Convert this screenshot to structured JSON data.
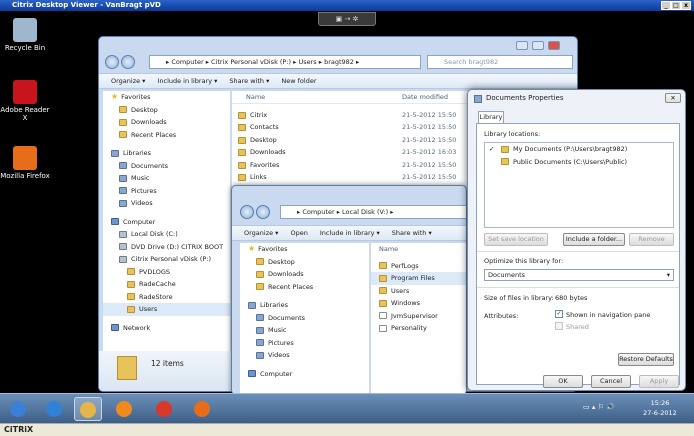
{
  "window_title": "Citrix Desktop Viewer - VanBragt pVD",
  "toolbar_glyph": "▣ ⇢ ✲",
  "desktop_icons": [
    {
      "label": "Recycle Bin",
      "icon": "recycle-bin-icon",
      "color": "#9fb7cc"
    },
    {
      "label": "Adobe Reader X",
      "icon": "adobe-reader-icon",
      "color": "#c8141c"
    },
    {
      "label": "Mozilla Firefox",
      "icon": "firefox-icon",
      "color": "#e76d1b"
    }
  ],
  "explorer1": {
    "breadcrumb": "▸ Computer ▸ Citrix Personal vDisk (P:) ▸ Users ▸ bragt982 ▸",
    "search_placeholder": "Search bragt982",
    "commands": [
      "Organize ▾",
      "Include in library ▾",
      "Share with ▾",
      "New folder"
    ],
    "nav": [
      {
        "label": "Favorites",
        "kind": "star",
        "level": 0
      },
      {
        "label": "Desktop",
        "kind": "folder",
        "level": 1
      },
      {
        "label": "Downloads",
        "kind": "folder",
        "level": 1
      },
      {
        "label": "Recent Places",
        "kind": "folder",
        "level": 1
      },
      {
        "label": "",
        "kind": "gap",
        "level": 0
      },
      {
        "label": "Libraries",
        "kind": "lib",
        "level": 0
      },
      {
        "label": "Documents",
        "kind": "lib",
        "level": 1
      },
      {
        "label": "Music",
        "kind": "lib",
        "level": 1
      },
      {
        "label": "Pictures",
        "kind": "lib",
        "level": 1
      },
      {
        "label": "Videos",
        "kind": "lib",
        "level": 1
      },
      {
        "label": "",
        "kind": "gap",
        "level": 0
      },
      {
        "label": "Computer",
        "kind": "pc",
        "level": 0
      },
      {
        "label": "Local Disk (C:)",
        "kind": "drive",
        "level": 1
      },
      {
        "label": "DVD Drive (D:) CITRIX BOOT",
        "kind": "drive",
        "level": 1
      },
      {
        "label": "Citrix Personal vDisk (P:)",
        "kind": "drive",
        "level": 1
      },
      {
        "label": "PVDLOGS",
        "kind": "folder",
        "level": 2
      },
      {
        "label": "RadeCache",
        "kind": "folder",
        "level": 2
      },
      {
        "label": "RadeStore",
        "kind": "folder",
        "level": 2
      },
      {
        "label": "Users",
        "kind": "folder",
        "level": 2,
        "selected": true
      },
      {
        "label": "",
        "kind": "gap",
        "level": 0
      },
      {
        "label": "Network",
        "kind": "pc",
        "level": 0
      }
    ],
    "col_name": "Name",
    "col_date": "Date modified",
    "files": [
      {
        "name": "Citrix",
        "date": "21-5-2012 15:50"
      },
      {
        "name": "Contacts",
        "date": "21-5-2012 15:50"
      },
      {
        "name": "Desktop",
        "date": "21-5-2012 15:50"
      },
      {
        "name": "Downloads",
        "date": "21-5-2012 16:03"
      },
      {
        "name": "Favorites",
        "date": "21-5-2012 15:50"
      },
      {
        "name": "Links",
        "date": "21-5-2012 15:50"
      }
    ],
    "status": "12 items"
  },
  "explorer2": {
    "breadcrumb": "▸ Computer ▸ Local Disk (V:) ▸",
    "commands": [
      "Organize ▾",
      "Open",
      "Include in library ▾",
      "Share with ▾"
    ],
    "nav": [
      {
        "label": "Favorites",
        "kind": "star",
        "level": 0
      },
      {
        "label": "Desktop",
        "kind": "folder",
        "level": 1
      },
      {
        "label": "Downloads",
        "kind": "folder",
        "level": 1
      },
      {
        "label": "Recent Places",
        "kind": "folder",
        "level": 1
      },
      {
        "label": "",
        "kind": "gap",
        "level": 0
      },
      {
        "label": "Libraries",
        "kind": "lib",
        "level": 0
      },
      {
        "label": "Documents",
        "kind": "lib",
        "level": 1
      },
      {
        "label": "Music",
        "kind": "lib",
        "level": 1
      },
      {
        "label": "Pictures",
        "kind": "lib",
        "level": 1
      },
      {
        "label": "Videos",
        "kind": "lib",
        "level": 1
      },
      {
        "label": "",
        "kind": "gap",
        "level": 0
      },
      {
        "label": "Computer",
        "kind": "pc",
        "level": 0
      }
    ],
    "col_name": "Name",
    "files": [
      {
        "name": "PerfLogs",
        "kind": "folder"
      },
      {
        "name": "Program Files",
        "kind": "folder",
        "selected": true
      },
      {
        "name": "Users",
        "kind": "folder"
      },
      {
        "name": "Windows",
        "kind": "folder"
      },
      {
        "name": "JvmSupervisor",
        "kind": "file"
      },
      {
        "name": "Personality",
        "kind": "file"
      }
    ]
  },
  "dialog": {
    "title": "Documents Properties",
    "tab": "Library",
    "locations_label": "Library locations:",
    "locations": [
      {
        "check": "✓",
        "text": "My Documents (P:\\Users\\bragt982)"
      },
      {
        "check": "",
        "text": "Public Documents (C:\\Users\\Public)"
      }
    ],
    "set_save": "Set save location",
    "include_folder": "Include a folder...",
    "remove": "Remove",
    "optimize_label": "Optimize this library for:",
    "optimize_value": "Documents",
    "size_label": "Size of files in library:",
    "size_value": "680 bytes",
    "attributes_label": "Attributes:",
    "attr_shown": "Shown in navigation pane",
    "attr_shared": "Shared",
    "restore": "Restore Defaults",
    "ok": "OK",
    "cancel": "Cancel",
    "apply": "Apply",
    "close": "✕"
  },
  "taskbar": {
    "items": [
      {
        "icon": "start-orb-icon",
        "color": "#3b7fd6"
      },
      {
        "icon": "internet-explorer-icon",
        "color": "#2f82d8"
      },
      {
        "icon": "windows-explorer-icon",
        "color": "#e3b64a"
      },
      {
        "icon": "media-player-icon",
        "color": "#f08a1c"
      },
      {
        "icon": "chrome-icon",
        "color": "#d9392b"
      },
      {
        "icon": "firefox-icon",
        "color": "#e76d1b"
      }
    ],
    "tray_glyphs": "▭ ▴ ⚐ 🔊",
    "time": "15:26",
    "date": "27-6-2012"
  },
  "citrix_logo": "CiTRiX"
}
